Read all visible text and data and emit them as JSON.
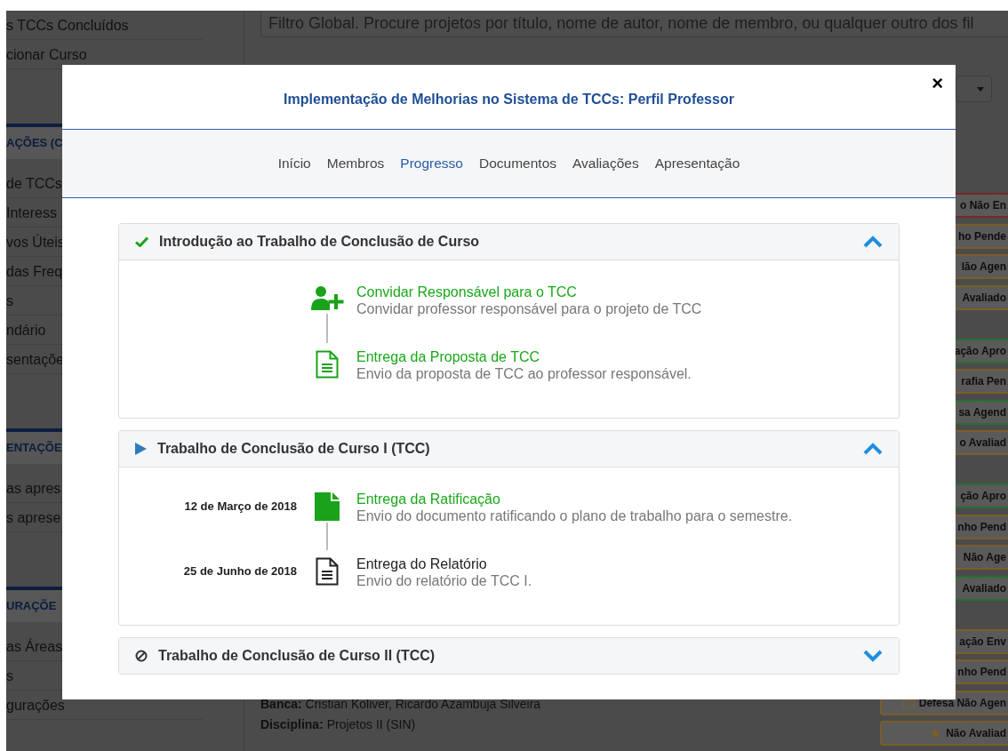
{
  "sidebar": {
    "sections": [
      {
        "items": [
          "s TCCs Concluídos",
          "cionar Curso"
        ]
      },
      {
        "heading": "AÇÕES (C",
        "items": [
          "de TCCs",
          "Interess",
          "vos Úteis",
          "das Freq",
          "s",
          "ndário",
          "sentaçõe"
        ]
      },
      {
        "heading": "ENTAÇÕE",
        "items": [
          "as apres",
          "s aprese"
        ]
      },
      {
        "heading": "URAÇÕE",
        "items": [
          "as Áreas",
          "s",
          "gurações"
        ]
      }
    ]
  },
  "filter": {
    "placeholder": "Filtro Global. Procure projetos por título, nome de autor, nome de membro, ou qualquer outro dos fil"
  },
  "status_groups": [
    {
      "badges": [
        {
          "label": "o Não En",
          "color": "#7a2626",
          "kind": "plain"
        },
        {
          "label": "ho Pende",
          "color": "#7a5e28",
          "kind": "plain"
        },
        {
          "label": "lão Agen",
          "color": "#7a5e28",
          "kind": "plain"
        },
        {
          "label": "Avaliado",
          "color": "#7a5e28",
          "kind": "plain"
        }
      ]
    },
    {
      "badges": [
        {
          "label": "ação Apro",
          "color": "#2a6b36",
          "kind": "plain"
        },
        {
          "label": "rafia Pen",
          "color": "#7a5e28",
          "kind": "plain"
        },
        {
          "label": "sa Agend",
          "color": "#2a6b36",
          "kind": "plain"
        },
        {
          "label": "o Avaliad",
          "color": "#7a5e28",
          "kind": "plain"
        }
      ]
    },
    {
      "badges": [
        {
          "label": "ção Apro",
          "color": "#2a6b36",
          "kind": "plain"
        },
        {
          "label": "nho Pend",
          "color": "#7a5e28",
          "kind": "plain"
        },
        {
          "label": "Não Age",
          "color": "#7a5e28",
          "kind": "plain"
        },
        {
          "label": "Avaliado",
          "color": "#2a6b36",
          "kind": "plain"
        }
      ]
    },
    {
      "badges": [
        {
          "label": "ação Env",
          "color": "#7a5e28",
          "kind": "plain"
        },
        {
          "label": "nho Pend",
          "color": "#7a5e28",
          "kind": "plain"
        },
        {
          "label": "Defesa Não Agen",
          "color": "#7a5e28",
          "kind": "calendar"
        },
        {
          "label": "Não Avaliad",
          "color": "#7a5e28",
          "kind": "star"
        }
      ]
    }
  ],
  "project_details": [
    "**Banca:** Cristian Koliver, Ricardo Azambuja Silveira",
    "**Disciplina:** Projetos II (SIN)"
  ],
  "modal": {
    "title": "Implementação de Melhorias no Sistema de TCCs: Perfil Professor",
    "close": "×",
    "tabs": [
      {
        "label": "Início",
        "selected": false
      },
      {
        "label": "Membros",
        "selected": false
      },
      {
        "label": "Progresso",
        "selected": true
      },
      {
        "label": "Documentos",
        "selected": false
      },
      {
        "label": "Avaliações",
        "selected": false
      },
      {
        "label": "Apresentação",
        "selected": false
      }
    ],
    "panels": [
      {
        "title": "Introdução ao Trabalho de Conclusão de Curso",
        "kind": "done",
        "expanded": true,
        "steps": [
          {
            "title": "Convidar Responsável para o TCC",
            "description": "Convidar professor responsável para o projeto de TCC",
            "kind": "invite",
            "done": true
          },
          {
            "title": "Entrega da Proposta de TCC",
            "description": "Envio da proposta de TCC ao professor responsável.",
            "kind": "document",
            "done": true
          }
        ]
      },
      {
        "title": "Trabalho de Conclusão de Curso I (TCC)",
        "kind": "current",
        "expanded": true,
        "steps": [
          {
            "date": "12 de Março de 2018",
            "title": "Entrega da Ratificação",
            "description": "Envio do documento ratificando o plano de trabalho para o semestre.",
            "kind": "document-solid",
            "done": true
          },
          {
            "date": "25 de Junho de 2018",
            "title": "Entrega do Relatório",
            "description": "Envio do relatório de TCC I.",
            "kind": "document",
            "done": false
          }
        ]
      },
      {
        "title": "Trabalho de Conclusão de Curso II (TCC)",
        "kind": "blocked",
        "expanded": false
      }
    ]
  }
}
